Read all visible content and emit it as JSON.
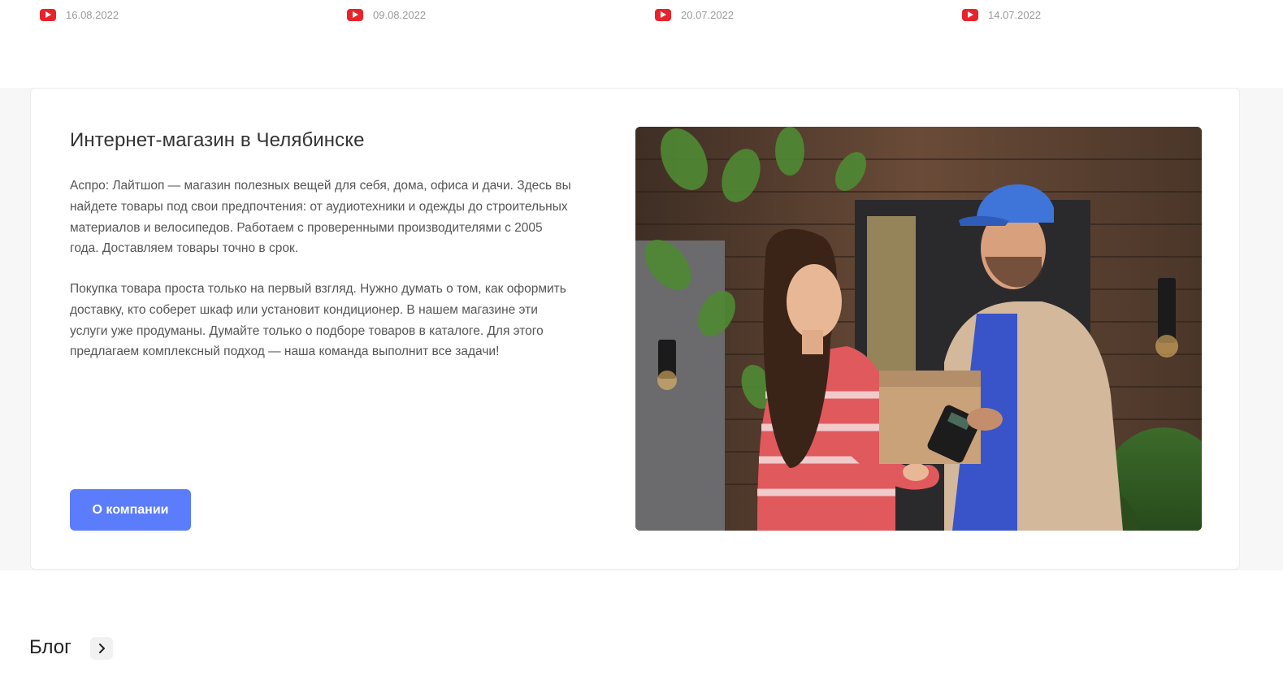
{
  "videos": [
    {
      "date": "16.08.2022",
      "icon": "youtube-icon"
    },
    {
      "date": "09.08.2022",
      "icon": "youtube-icon"
    },
    {
      "date": "20.07.2022",
      "icon": "youtube-icon"
    },
    {
      "date": "14.07.2022",
      "icon": "youtube-icon"
    }
  ],
  "about": {
    "title": "Интернет-магазин в Челябинске",
    "paragraph_1": "Аспро: Лайтшоп — магазин полезных вещей для себя, дома, офиса и дачи. Здесь вы найдете товары под свои предпочтения: от аудиотехники и одежды до строительных материалов и велосипедов. Работаем с проверенными производителями с 2005 года. Доставляем товары точно в срок.",
    "paragraph_2": "Покупка товара проста только на первый взгляд. Нужно думать о том, как оформить доставку, кто соберет шкаф или установит кондиционер. В нашем магазине эти услуги уже продуманы. Думайте только о подборе товаров в каталоге. Для этого предлагаем комплексный подход — наша команда выполнит все задачи!",
    "button_label": "О компании"
  },
  "blog": {
    "title": "Блог",
    "arrow_icon": "chevron-right-icon"
  },
  "colors": {
    "accent": "#5b7cfb",
    "youtube": "#e8232a"
  }
}
